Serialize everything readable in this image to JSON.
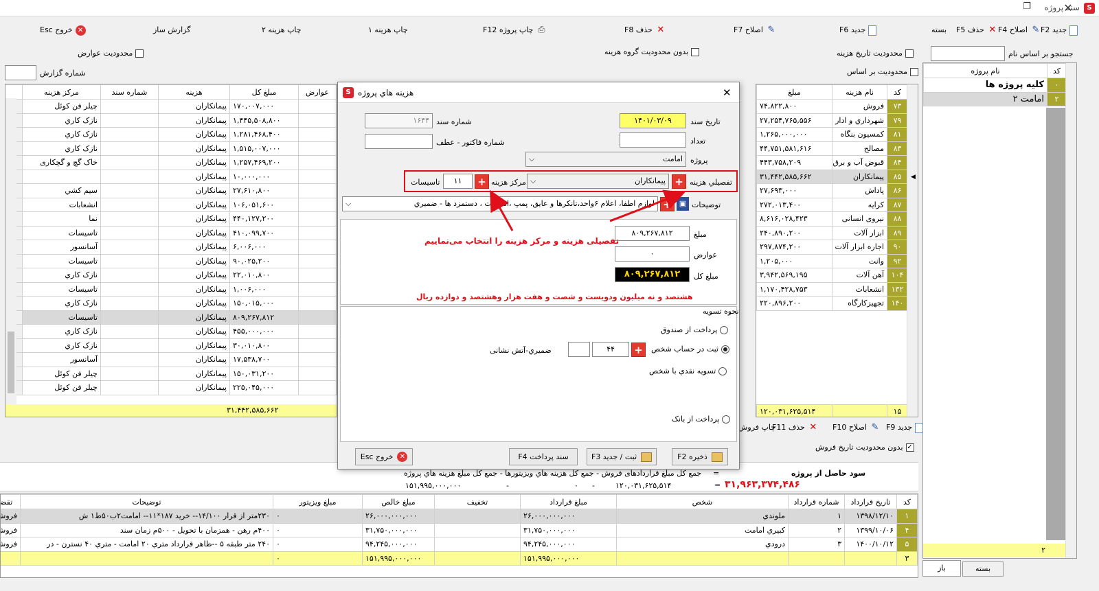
{
  "window": {
    "title": "سند پروژه",
    "app_icon": "S"
  },
  "toolbar": {
    "new": "جدید F6",
    "edit": "اصلاح F7",
    "delete": "حذف F8",
    "print_project": "چاپ پروژه F12",
    "print_cost1": "چاپ هزینه ۱",
    "print_cost2": "چاپ هزینه ۲",
    "report_builder": "گزارش ساز",
    "exit": "خروج Esc"
  },
  "filters": {
    "limit_charges": "محدودیت عوارض",
    "no_limit_cost_group": "بدون محدودیت گروه هزینه",
    "limit_cost_date": "محدودیت تاریخ هزینه",
    "limit_by_basis": "محدودیت بر اساس",
    "report_number_label": "شماره گزارش",
    "report_number_value": ""
  },
  "right_panel": {
    "toolbar": {
      "new": "جدید F2",
      "edit": "اصلاح F4",
      "delete": "حذف F5",
      "close": "بسته"
    },
    "search_label": "جستجو بر اساس نام",
    "search_value": "",
    "headers": {
      "code": "کد",
      "name": "نام پروژه"
    },
    "rows": [
      {
        "code": "۰",
        "name": "کلیه پروژه ها"
      },
      {
        "code": "۲",
        "name": "امامت ۲"
      }
    ],
    "footer_count": "۲",
    "tabs": {
      "closed": "بسته",
      "open": "باز"
    }
  },
  "cost_types": {
    "headers": {
      "code": "کد",
      "name": "نام هزینه",
      "amount": "مبلغ"
    },
    "rows": [
      {
        "code": "۷۳",
        "name": "فروش",
        "amount": "۷۴,۸۲۲,۸۰۰"
      },
      {
        "code": "۷۹",
        "name": "شهرداري و ادار",
        "amount": "۲۷,۲۵۴,۷۶۵,۵۵۶"
      },
      {
        "code": "۸۱",
        "name": "کمسیون بنگاه",
        "amount": "۱,۲۶۵,۰۰۰,۰۰۰"
      },
      {
        "code": "۸۳",
        "name": "مصالح",
        "amount": "۴۴,۷۵۱,۵۸۱,۶۱۶"
      },
      {
        "code": "۸۴",
        "name": "قبوض آب و برق",
        "amount": "۴۴۳,۷۵۸,۲۰۹"
      },
      {
        "code": "۸۵",
        "name": "پیمانکاران",
        "amount": "۳۱,۴۴۲,۵۸۵,۶۶۲"
      },
      {
        "code": "۸۶",
        "name": "پاداش",
        "amount": "۲۷,۶۹۳,۰۰۰"
      },
      {
        "code": "۸۷",
        "name": "کرایه",
        "amount": "۲۷۲,۰۱۳,۴۰۰"
      },
      {
        "code": "۸۸",
        "name": "نیروی انسانی",
        "amount": "۸,۶۱۶,۰۲۸,۴۲۳"
      },
      {
        "code": "۸۹",
        "name": "ابزار آلات",
        "amount": "۲۴۰,۸۹۰,۲۰۰"
      },
      {
        "code": "۹۰",
        "name": "اجاره ابزار آلات",
        "amount": "۲۹۷,۸۷۴,۲۰۰"
      },
      {
        "code": "۹۲",
        "name": "وانت",
        "amount": "۱,۲۰۵,۰۰۰"
      },
      {
        "code": "۱۰۴",
        "name": "آهن آلات",
        "amount": "۳,۹۴۲,۵۶۹,۱۹۵"
      },
      {
        "code": "۱۳۲",
        "name": "انشعابات",
        "amount": "۱,۱۷۰,۴۲۸,۷۵۳"
      },
      {
        "code": "۱۴۰",
        "name": "تجهیزکارگاه",
        "amount": "۲۲۰,۸۹۶,۲۰۰"
      }
    ],
    "footer": {
      "count": "۱۵",
      "total": "۱۲۰,۰۳۱,۶۲۵,۵۱۴"
    },
    "toolbar": {
      "new": "جدید F9",
      "edit": "اصلاح F10",
      "delete": "حذف F11",
      "print_sales": "چاپ فروش"
    },
    "no_limit_sales_date": "بدون محدودیت تاریخ فروش"
  },
  "doc_grid": {
    "headers": {
      "charges": "عوارض",
      "total": "مبلغ کل",
      "cost": "هزینه",
      "doc_no": "شماره سند",
      "cost_center": "مرکز هزینه"
    },
    "rows": [
      {
        "total": "۱۷۰,۰۰۷,۰۰۰",
        "cost": "پیمانکاران",
        "center": "چیلر فن کوئل"
      },
      {
        "total": "۱,۴۴۵,۵۰۸,۸۰۰",
        "cost": "پیمانکاران",
        "center": "نازک کاري"
      },
      {
        "total": "۱,۲۸۱,۴۶۸,۴۰۰",
        "cost": "پیمانکاران",
        "center": "نازک کاري"
      },
      {
        "total": "۱,۵۱۵,۰۰۷,۰۰۰",
        "cost": "پیمانکاران",
        "center": "نازک کاري"
      },
      {
        "total": "۱,۲۵۷,۴۶۹,۲۰۰",
        "cost": "پیمانکاران",
        "center": "خاک گچ و گچکاری"
      },
      {
        "total": "۱۰,۰۰۰,۰۰۰",
        "cost": "پیمانکاران",
        "center": ""
      },
      {
        "total": "۲۷,۶۱۰,۸۰۰",
        "cost": "پیمانکاران",
        "center": "سیم کشي"
      },
      {
        "total": "۱۰۶,۰۵۱,۶۰۰",
        "cost": "پیمانکاران",
        "center": "انشعابات"
      },
      {
        "total": "۴۴۰,۱۲۷,۲۰۰",
        "cost": "پیمانکاران",
        "center": "نما"
      },
      {
        "total": "۴۱۰,۰۹۹,۷۰۰",
        "cost": "پیمانکاران",
        "center": "تاسیسات"
      },
      {
        "total": "۶,۰۰۶,۰۰۰",
        "cost": "پیمانکاران",
        "center": "آسانسور"
      },
      {
        "total": "۹۰,۰۲۵,۲۰۰",
        "cost": "پیمانکاران",
        "center": "تاسیسات"
      },
      {
        "total": "۲۲,۰۱۰,۸۰۰",
        "cost": "پیمانکاران",
        "center": "نازک کاري"
      },
      {
        "total": "۱,۰۰۶,۰۰۰",
        "cost": "پیمانکاران",
        "center": "تاسیسات"
      },
      {
        "total": "۱۵۰,۰۱۵,۰۰۰",
        "cost": "پیمانکاران",
        "center": "نازک کاري"
      },
      {
        "total": "۸۰۹,۲۶۷,۸۱۲",
        "cost": "پیمانکاران",
        "center": "تاسیسات"
      },
      {
        "total": "۴۵۵,۰۰۰,۰۰۰",
        "cost": "پیمانکاران",
        "center": "نازک کاري"
      },
      {
        "total": "۳۰,۰۱۰,۸۰۰",
        "cost": "پیمانکاران",
        "center": "نازک کاري"
      },
      {
        "total": "۱۷,۵۳۸,۷۰۰",
        "cost": "پیمانکاران",
        "center": "آسانسور"
      },
      {
        "total": "۱۵۰,۰۳۱,۲۰۰",
        "cost": "پیمانکاران",
        "center": "چیلر فن کوئل"
      },
      {
        "total": "۲۲۵,۰۴۵,۰۰۰",
        "cost": "پیمانکاران",
        "center": "چیلر فن کوئل"
      }
    ],
    "footer_total": "۳۱,۴۴۲,۵۸۵,۶۶۲"
  },
  "summary": {
    "profit_label": "سود حاصل از پروژه",
    "eq": "=",
    "formula": "جمع کل مبلغ قراردادهای فروش  -  جمع کل هزینه هاي ویزیتورها  -  جمع کل مبلغ هزینه هاي پروژه",
    "v1": "۱۵۱,۹۹۵,۰۰۰,۰۰۰",
    "dash1": "-",
    "v2": "۰",
    "dash2": "-",
    "v3": "۱۲۰,۰۳۱,۶۲۵,۵۱۴",
    "result": "۳۱,۹۶۳,۳۷۴,۴۸۶"
  },
  "sales": {
    "headers": {
      "code": "کد",
      "date": "تاریخ قرارداد",
      "contract_no": "شماره قرارداد",
      "person": "شخص",
      "contract_amount": "مبلغ قرارداد",
      "discount": "تخفیف",
      "net": "مبلغ خالص",
      "visitor": "مبلغ ویزیتور",
      "desc": "توضیحات",
      "req": "تقضا"
    },
    "rows": [
      {
        "code": "۱",
        "date": "۱۳۹۸/۱۲/۱۰",
        "no": "۱",
        "person": "ملوندي",
        "amount": "۲۶,۰۰۰,۰۰۰,۰۰۰",
        "discount": "",
        "net": "۲۶,۰۰۰,۰۰۰,۰۰۰",
        "visitor": "۰",
        "desc": "۲۳۰متر از قرار ۱۴/۱۰۰-- خرید ۱۸۷*۱۱-- امامت۲ب۵۰ط۱ ش",
        "req": "فروش"
      },
      {
        "code": "۴",
        "date": "۱۳۹۹/۱۰/۰۶",
        "no": "۲",
        "person": "کبیري امامت",
        "amount": "۳۱,۷۵۰,۰۰۰,۰۰۰",
        "discount": "",
        "net": "۳۱,۷۵۰,۰۰۰,۰۰۰",
        "visitor": "۰",
        "desc": "۴۰۰م رهن - همزمان با تحویل - ۵۰۰م زمان سند",
        "req": "فروش"
      },
      {
        "code": "۵",
        "date": "۱۴۰۰/۱۰/۱۲",
        "no": "۳",
        "person": "درودي",
        "amount": "۹۴,۲۴۵,۰۰۰,۰۰۰",
        "discount": "",
        "net": "۹۴,۲۴۵,۰۰۰,۰۰۰",
        "visitor": "۰",
        "desc": "۲۴۰ متر طبقه ۵ --ظاهر قرارداد متري ۲۰ امامت - متري ۴۰ نسترن - در",
        "req": "فروش"
      }
    ],
    "footer": {
      "count": "۳",
      "amount": "۱۵۱,۹۹۵,۰۰۰,۰۰۰",
      "net": "۱۵۱,۹۹۵,۰۰۰,۰۰۰",
      "visitor": "۰"
    }
  },
  "modal": {
    "title": "هزینه هاي پروژه",
    "doc_date_label": "تاریخ سند",
    "doc_date": "۱۴۰۱/۰۳/۰۹",
    "doc_no_label": "شماره سند",
    "doc_no": "۱۶۴۴",
    "count_label": "تعداد",
    "count": "",
    "invoice_label": "شماره فاکتور - عطف",
    "invoice": "",
    "project_label": "پروژه",
    "project": "امامت",
    "cost_detail_label": "تفصیلي هزینه",
    "cost_detail": "پیمانکاران",
    "cost_center_label": "مرکز هزینه",
    "cost_center_code": "۱۱",
    "cost_center_name": "تاسیسات",
    "desc_label": "توضیحات",
    "desc": "لوازم اطفا، اعلام ۶واحد،تانکرها و عایق، پمپ ،اتصالات ، دستمزد ها - ضمیري",
    "annotation": "تفصیلی هزینه و مرکز هزینه را انتخاب می‌نماییم",
    "amount_label": "مبلغ",
    "amount": "۸۰۹,۲۶۷,۸۱۲",
    "charges_label": "عوارض",
    "charges": "۰",
    "total_label": "مبلغ کل",
    "total": "۸۰۹,۲۶۷,۸۱۲",
    "amount_words": "هشتصد و نه میلیون ودویست و شصت و هفت هزار وهشتصد و دوازده   ریال",
    "settlement_label": "نحوه تسویه",
    "opt_cashbox": "پرداخت از صندوق",
    "opt_person_account": "ثبت در حساب شخص",
    "person_code": "۴۴",
    "person_sub": "",
    "person_name": "ضمیري-آتش نشانی",
    "opt_cash_person": "تسویه نقدي با شخص",
    "opt_bank": "پرداخت از بانک",
    "btn_save": "ذخیره F2",
    "btn_save_new": "ثبت / جدید  F3",
    "btn_payment": "سند پرداخت F4",
    "btn_exit": "خروج  Esc"
  },
  "colors": {
    "highlight_row": "#d9d9d9",
    "code_col": "#a8a62c",
    "footer_yellow": "#fdfd96",
    "annotation_red": "#e0101a",
    "date_bg": "#ffff66"
  }
}
